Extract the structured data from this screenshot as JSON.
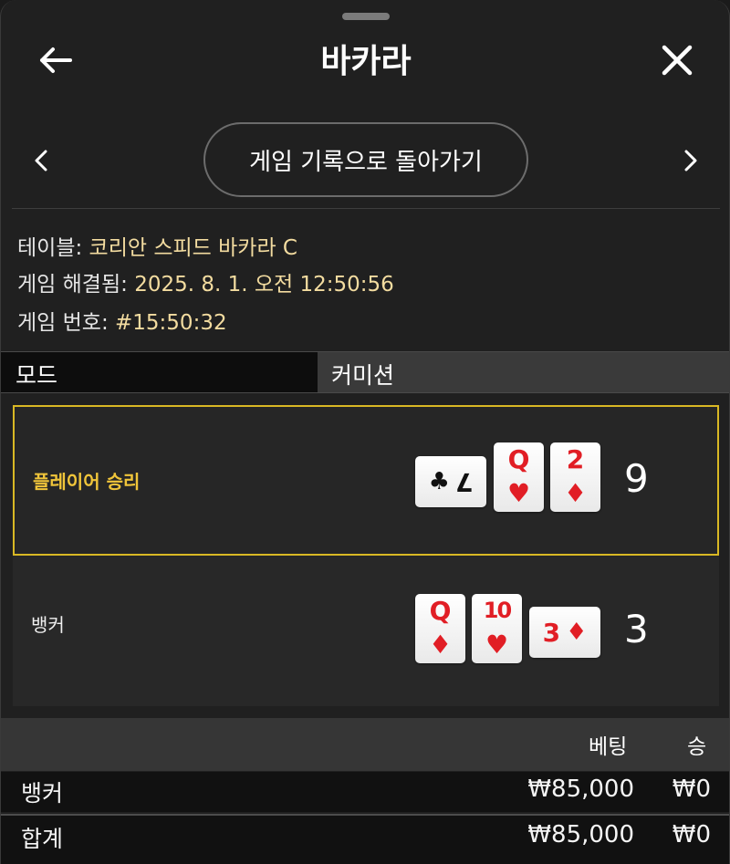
{
  "header": {
    "title": "바카라",
    "back_icon": "arrow-left-icon",
    "close_icon": "close-icon"
  },
  "nav": {
    "prev_icon": "chevron-left-icon",
    "next_icon": "chevron-right-icon",
    "return_label": "게임 기록으로 돌아가기"
  },
  "info": {
    "table_label": "테이블:",
    "table_value": "코리안 스피드 바카라 C",
    "resolved_label": "게임 해결됨:",
    "resolved_value": "2025. 8. 1. 오전 12:50:56",
    "game_no_label": "게임 번호:",
    "game_no_value": "#15:50:32"
  },
  "mode": {
    "label": "모드",
    "value": "커미션"
  },
  "results": {
    "player": {
      "label": "플레이어 승리",
      "score": "9",
      "winner": true,
      "cards": [
        {
          "rank": "7",
          "suit": "♣",
          "color": "black",
          "orientation": "sideways"
        },
        {
          "rank": "Q",
          "suit": "♥",
          "color": "red",
          "orientation": "upright"
        },
        {
          "rank": "2",
          "suit": "♦",
          "color": "red",
          "orientation": "upright"
        }
      ]
    },
    "banker": {
      "label": "뱅커",
      "score": "3",
      "winner": false,
      "cards": [
        {
          "rank": "Q",
          "suit": "♦",
          "color": "red",
          "orientation": "upright"
        },
        {
          "rank": "10",
          "suit": "♥",
          "color": "red",
          "orientation": "upright"
        },
        {
          "rank": "3",
          "suit": "♦",
          "color": "red",
          "orientation": "sideways"
        }
      ]
    }
  },
  "bets": {
    "headers": {
      "bet": "베팅",
      "win": "승"
    },
    "rows": [
      {
        "name": "뱅커",
        "bet": "₩85,000",
        "win": "₩0"
      },
      {
        "name": "합계",
        "bet": "₩85,000",
        "win": "₩0"
      }
    ]
  },
  "colors": {
    "accent_gold": "#d9b824",
    "info_value": "#f3dca0",
    "card_red": "#e11e25"
  }
}
